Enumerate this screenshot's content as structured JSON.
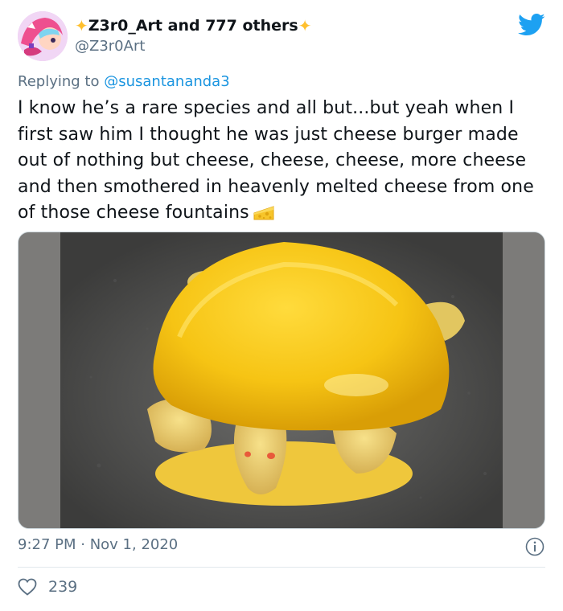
{
  "author": {
    "display_name": "Z3r0_Art and 777 others",
    "handle": "@Z3r0Art",
    "avatar_icon": "avatar-illustration",
    "decorations": [
      "sparkle-icon",
      "sparkle-icon"
    ]
  },
  "platform_icon": "twitter-bird-icon",
  "reply": {
    "prefix": "Replying to",
    "mention": "@susantananda3"
  },
  "tweet": {
    "text": "I know he’s a rare species and all but...but yeah when I first saw him I thought he was just cheese burger made out of nothing but cheese, cheese, cheese, more cheese and then smothered in heavenly melted cheese from one of those cheese fountains",
    "emoji": "cheese-wedge-icon"
  },
  "media": {
    "subject": "yellow-turtle-photo"
  },
  "meta": {
    "time": "9:27 PM",
    "separator": " · ",
    "date": "Nov 1, 2020",
    "info_icon": "info-icon"
  },
  "engagement": {
    "likes": "239",
    "like_icon": "heart-icon"
  },
  "colors": {
    "link": "#1b95e0",
    "twitter_blue": "#1da1f2",
    "muted": "#5b7083",
    "turtle_yellow": "#f3c218"
  }
}
